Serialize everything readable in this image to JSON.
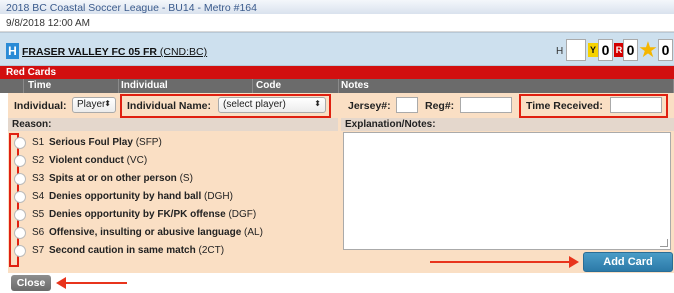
{
  "header": {
    "title": "2018 BC Coastal Soccer League - BU14 - Metro #164",
    "datetime": "9/8/2018   12:00 AM"
  },
  "team": {
    "badge": "H",
    "name": "FRASER VALLEY FC 05 FR",
    "code": " (CND:BC)",
    "side_label": "H",
    "yellow_label": "Y",
    "yellow_count": "0",
    "red_label": "R",
    "red_count": "0",
    "star_count": "0"
  },
  "section": {
    "title": "Red Cards",
    "columns": [
      "Time",
      "Individual",
      "Code",
      "Notes"
    ]
  },
  "form": {
    "individual_label": "Individual:",
    "individual_value": "Player",
    "individual_name_label": "Individual Name:",
    "individual_name_value": "(select player)",
    "jersey_label": "Jersey#:",
    "reg_label": "Reg#:",
    "time_received_label": "Time Received:"
  },
  "reason": {
    "header": "Reason:",
    "items": [
      {
        "code": "S1",
        "text": "Serious Foul Play",
        "abbr": " (SFP)"
      },
      {
        "code": "S2",
        "text": "Violent conduct",
        "abbr": " (VC)"
      },
      {
        "code": "S3",
        "text": "Spits at or on other person",
        "abbr": " (S)"
      },
      {
        "code": "S4",
        "text": "Denies opportunity by hand ball",
        "abbr": " (DGH)"
      },
      {
        "code": "S5",
        "text": "Denies opportunity by FK/PK offense",
        "abbr": " (DGF)"
      },
      {
        "code": "S6",
        "text": "Offensive, insulting or abusive language",
        "abbr": " (AL)"
      },
      {
        "code": "S7",
        "text": "Second caution in same match",
        "abbr": " (2CT)"
      }
    ]
  },
  "notes": {
    "header": "Explanation/Notes:"
  },
  "buttons": {
    "add_card": "Add Card",
    "close": "Close"
  }
}
